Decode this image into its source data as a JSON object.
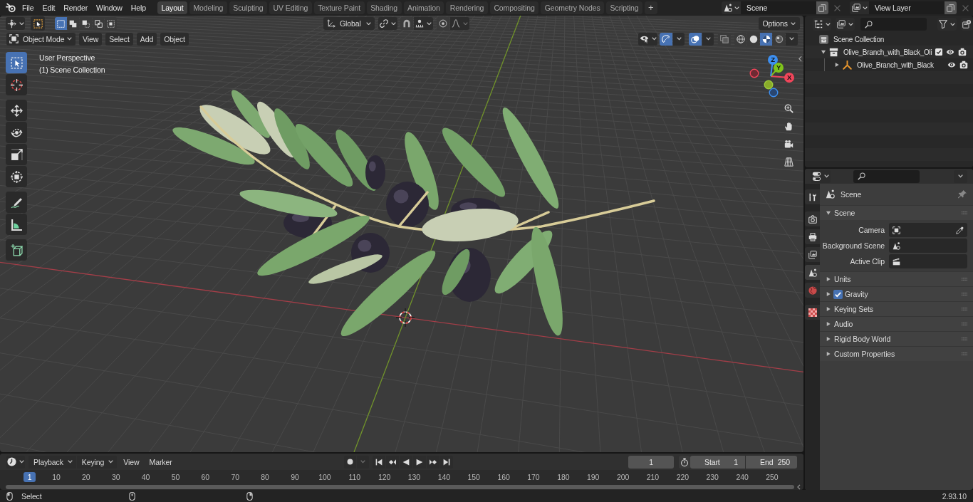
{
  "topbar": {
    "menu": [
      "File",
      "Edit",
      "Render",
      "Window",
      "Help"
    ],
    "workspaces": [
      {
        "label": "Layout",
        "selected": true
      },
      {
        "label": "Modeling",
        "selected": false
      },
      {
        "label": "Sculpting",
        "selected": false
      },
      {
        "label": "UV Editing",
        "selected": false
      },
      {
        "label": "Texture Paint",
        "selected": false
      },
      {
        "label": "Shading",
        "selected": false
      },
      {
        "label": "Animation",
        "selected": false
      },
      {
        "label": "Rendering",
        "selected": false
      },
      {
        "label": "Compositing",
        "selected": false
      },
      {
        "label": "Geometry Nodes",
        "selected": false
      },
      {
        "label": "Scripting",
        "selected": false
      }
    ],
    "add_workspace": "+",
    "scene": "Scene",
    "view_layer": "View Layer"
  },
  "viewport": {
    "select_modes": [
      {
        "kind": "set",
        "selected": true
      },
      {
        "kind": "extend",
        "selected": false
      },
      {
        "kind": "subtract",
        "selected": false
      },
      {
        "kind": "difference",
        "selected": false
      },
      {
        "kind": "intersect",
        "selected": false
      }
    ],
    "orientation": "Global",
    "snap": false,
    "proportional_editing": false,
    "options": "Options",
    "mode": "Object Mode",
    "menus": [
      "View",
      "Select",
      "Add",
      "Object"
    ],
    "gizmos": true,
    "overlays": true,
    "xray": false,
    "shading": [
      {
        "kind": "wireframe",
        "selected": false
      },
      {
        "kind": "solid",
        "selected": false
      },
      {
        "kind": "material",
        "selected": true
      },
      {
        "kind": "rendered",
        "selected": false
      }
    ],
    "info": [
      "User Perspective",
      "(1) Scene Collection"
    ],
    "tool_groups": [
      [
        {
          "kind": "select-box",
          "selected": true
        },
        {
          "kind": "cursor",
          "selected": false
        }
      ],
      [
        {
          "kind": "move",
          "selected": false
        },
        {
          "kind": "rotate",
          "selected": false
        },
        {
          "kind": "scale",
          "selected": false
        },
        {
          "kind": "transform",
          "selected": false
        }
      ],
      [
        {
          "kind": "annotate",
          "selected": false
        },
        {
          "kind": "measure",
          "selected": false
        }
      ],
      [
        {
          "kind": "add-cube",
          "selected": false
        }
      ]
    ],
    "axes": [
      "X",
      "Y",
      "Z"
    ]
  },
  "outliner": {
    "tree": [
      {
        "label": "Scene Collection",
        "kind": "scene",
        "children": [
          {
            "label": "Olive_Branch_with_Black_Oli",
            "kind": "collection",
            "expanded": true,
            "checked": true,
            "visible": true,
            "renderable": true,
            "children": [
              {
                "label": "Olive_Branch_with_Black",
                "kind": "object",
                "expanded": false,
                "visible": true,
                "renderable": true
              }
            ]
          }
        ]
      }
    ]
  },
  "properties": {
    "tab_groups": [
      [
        {
          "kind": "tool",
          "selected": false
        }
      ],
      [
        {
          "kind": "render",
          "selected": false
        },
        {
          "kind": "output",
          "selected": false
        },
        {
          "kind": "view-layer",
          "selected": false
        },
        {
          "kind": "scene",
          "selected": true
        },
        {
          "kind": "world",
          "selected": false
        }
      ],
      [
        {
          "kind": "texture",
          "selected": false
        }
      ]
    ],
    "context": "Scene",
    "panels": [
      {
        "label": "Scene",
        "expanded": true,
        "fields": [
          {
            "label": "Camera",
            "kind": "camera"
          },
          {
            "label": "Background Scene",
            "kind": "scene"
          },
          {
            "label": "Active Clip",
            "kind": "clip"
          }
        ]
      },
      {
        "label": "Units",
        "expanded": false
      },
      {
        "label": "Gravity",
        "expanded": false,
        "checked": true
      },
      {
        "label": "Keying Sets",
        "expanded": false
      },
      {
        "label": "Audio",
        "expanded": false
      },
      {
        "label": "Rigid Body World",
        "expanded": false
      },
      {
        "label": "Custom Properties",
        "expanded": false
      }
    ]
  },
  "timeline": {
    "dropdowns": [
      "Playback",
      "Keying"
    ],
    "menus": [
      "View",
      "Marker"
    ],
    "auto_keying": false,
    "frame": "1",
    "preview_range": false,
    "start_label": "Start",
    "start": "1",
    "end_label": "End",
    "end": "250",
    "playhead": "1",
    "ruler": [
      "10",
      "20",
      "30",
      "40",
      "50",
      "60",
      "70",
      "80",
      "90",
      "100",
      "110",
      "120",
      "130",
      "140",
      "150",
      "160",
      "170",
      "180",
      "190",
      "200",
      "210",
      "220",
      "230",
      "240",
      "250"
    ]
  },
  "statusbar": {
    "hints": [
      "Select"
    ],
    "version": "2.93.10"
  }
}
